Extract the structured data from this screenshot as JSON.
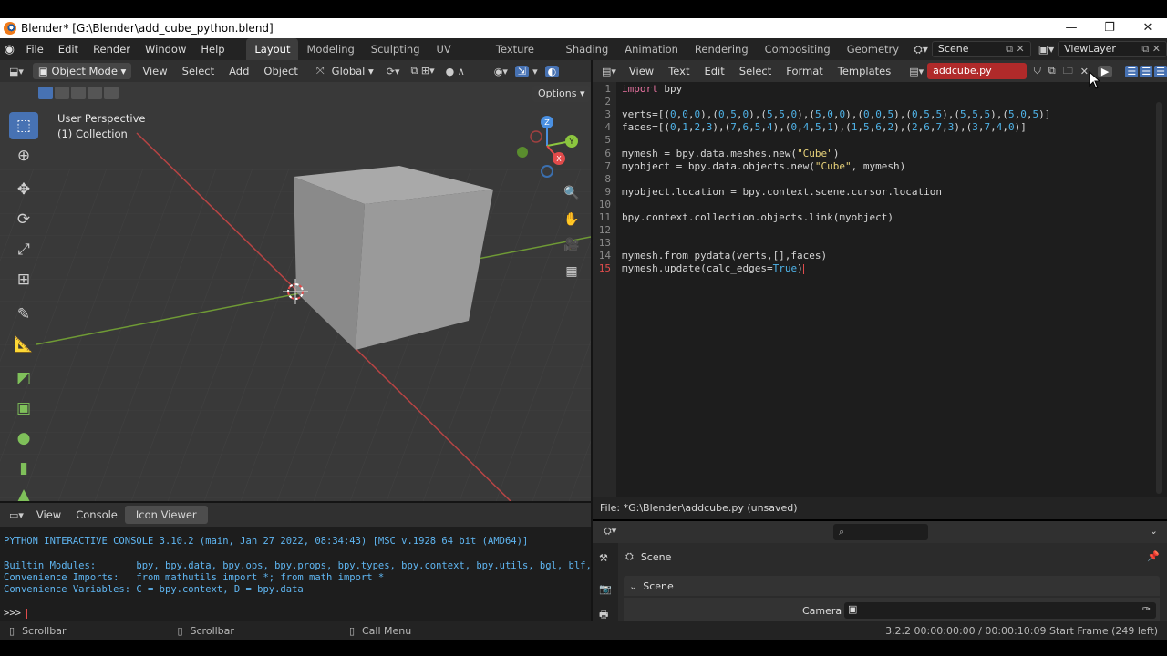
{
  "window": {
    "title": "Blender* [G:\\Blender\\add_cube_python.blend]",
    "controls": [
      "—",
      "❐",
      "✕"
    ]
  },
  "menu": {
    "items": [
      "File",
      "Edit",
      "Render",
      "Window",
      "Help"
    ],
    "workspaces": [
      "Layout",
      "Modeling",
      "Sculpting",
      "UV Editing",
      "Texture Paint",
      "Shading",
      "Animation",
      "Rendering",
      "Compositing",
      "Geometry Noc"
    ],
    "active_workspace": "Layout",
    "scene": "Scene",
    "view_layer": "ViewLayer"
  },
  "viewport": {
    "mode": "Object Mode",
    "menus": [
      "View",
      "Select",
      "Add",
      "Object"
    ],
    "transform_orientation": "Global",
    "options_label": "Options",
    "perspective_label": "User Perspective",
    "collection_label": "(1) Collection",
    "gizmo_axes": [
      "X",
      "Y",
      "Z"
    ]
  },
  "text_editor": {
    "menus": [
      "View",
      "Text",
      "Edit",
      "Select",
      "Format",
      "Templates"
    ],
    "filename": "addcube.py",
    "footer": "File: *G:\\Blender\\addcube.py (unsaved)",
    "current_line": 15,
    "lines": [
      "import bpy",
      "",
      "verts=[(0,0,0),(0,5,0),(5,5,0),(5,0,0),(0,0,5),(0,5,5),(5,5,5),(5,0,5)]",
      "faces=[(0,1,2,3),(7,6,5,4),(0,4,5,1),(1,5,6,2),(2,6,7,3),(3,7,4,0)]",
      "",
      "mymesh = bpy.data.meshes.new(\"Cube\")",
      "myobject = bpy.data.objects.new(\"Cube\", mymesh)",
      "",
      "myobject.location = bpy.context.scene.cursor.location",
      "",
      "bpy.context.collection.objects.link(myobject)",
      "",
      "",
      "mymesh.from_pydata(verts,[],faces)",
      "mymesh.update(calc_edges=True)"
    ],
    "line_numbers": [
      "1",
      "2",
      "3",
      "4",
      "5",
      "6",
      "7",
      "8",
      "9",
      "10",
      "11",
      "12",
      "13",
      "14",
      "15"
    ]
  },
  "console": {
    "tabs": [
      "View",
      "Console",
      "Icon Viewer"
    ],
    "active_tab": "Icon Viewer",
    "lines": [
      "PYTHON INTERACTIVE CONSOLE 3.10.2 (main, Jan 27 2022, 08:34:43) [MSC v.1928 64 bit (AMD64)]",
      "",
      "Builtin Modules:       bpy, bpy.data, bpy.ops, bpy.props, bpy.types, bpy.context, bpy.utils, bgl, blf, mathutils",
      "Convenience Imports:   from mathutils import *; from math import *",
      "Convenience Variables: C = bpy.context, D = bpy.data"
    ],
    "prompt": ">>> "
  },
  "properties": {
    "scene_label": "Scene",
    "panel_label": "Scene",
    "camera_label": "Camera"
  },
  "status_bar": {
    "left": [
      "Scrollbar",
      "Scrollbar",
      "Call Menu"
    ],
    "right": "3.2.2  00:00:00:00 / 00:00:10:09  Start Frame (249 left)"
  },
  "colors": {
    "accent_blue": "#4772b3",
    "x_axis": "#e24b4b",
    "y_axis": "#8cc63f",
    "z_axis": "#4a90e2",
    "viewport_bg": "#393939",
    "editor_bg": "#1d1d1d"
  }
}
